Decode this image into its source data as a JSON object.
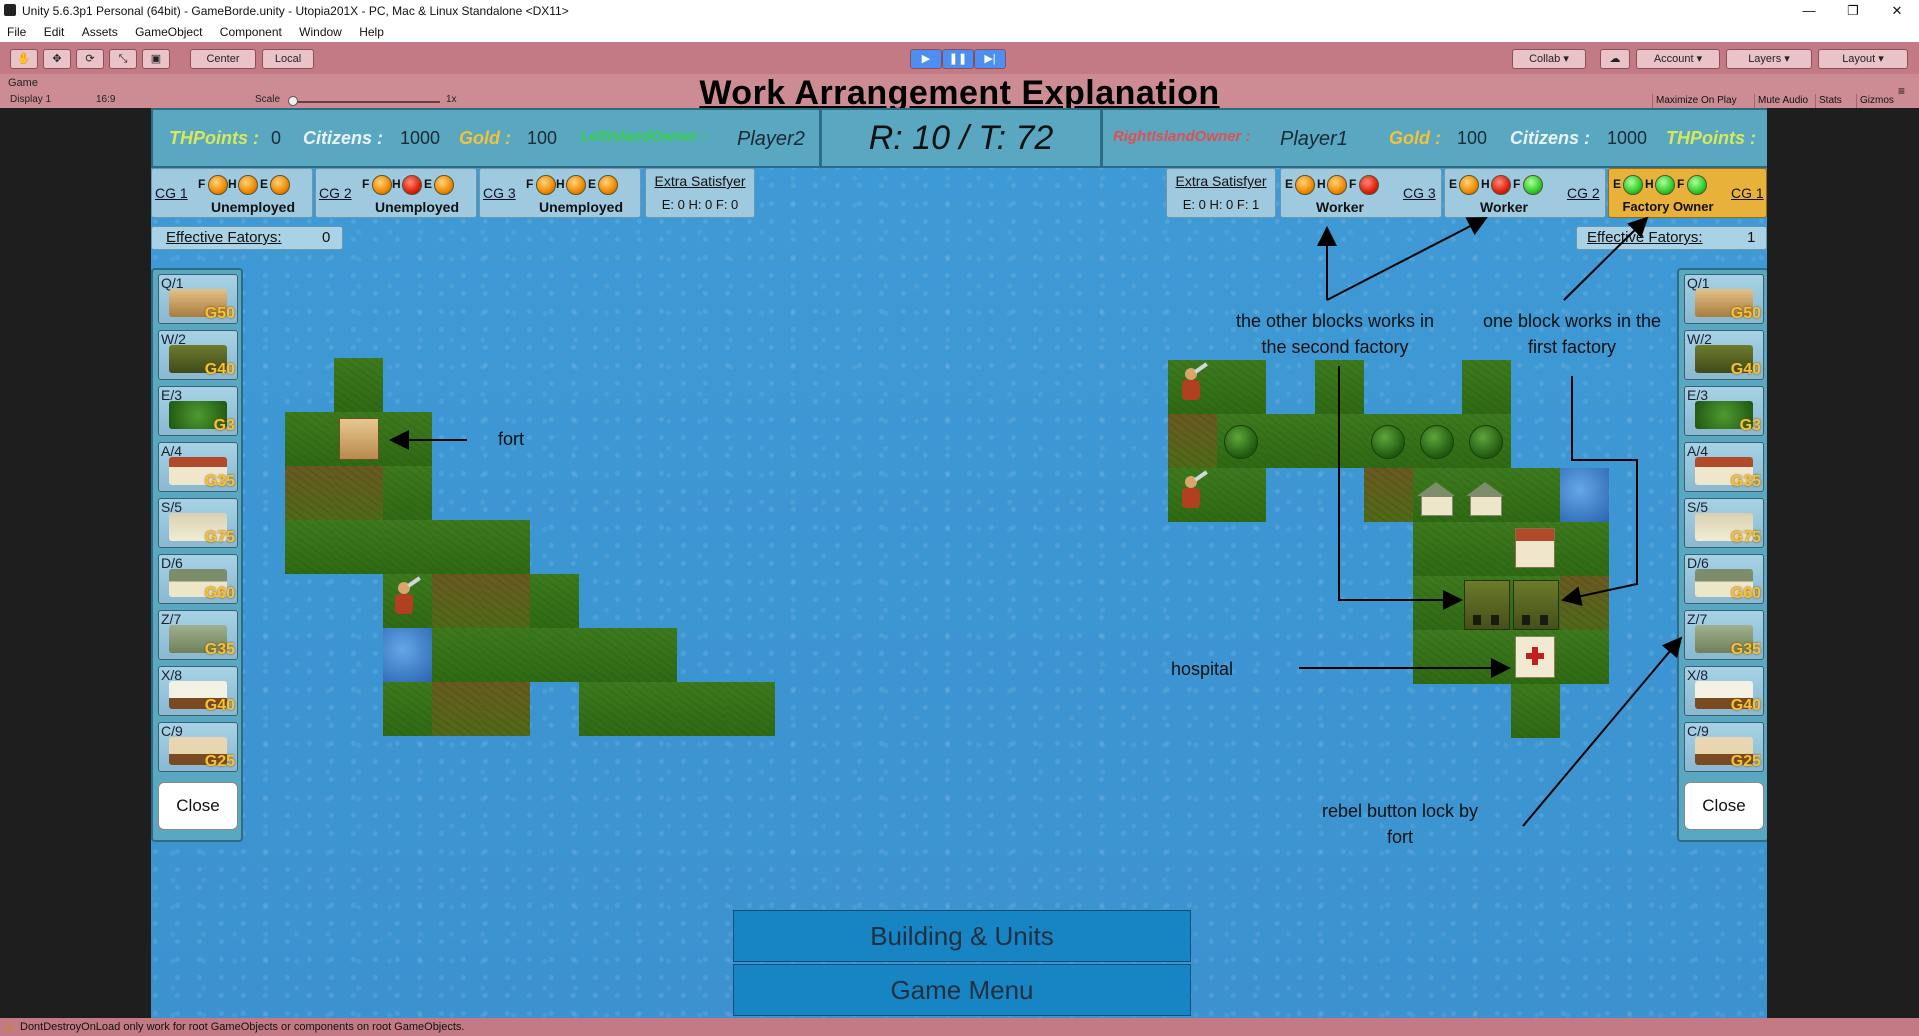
{
  "window": {
    "title": "Unity 5.6.3p1 Personal (64bit) - GameBorde.unity - Utopia201X - PC, Mac & Linux Standalone <DX11>",
    "minimize": "—",
    "restore": "❐",
    "close": "✕"
  },
  "menu": [
    "File",
    "Edit",
    "Assets",
    "GameObject",
    "Component",
    "Window",
    "Help"
  ],
  "toolbar": {
    "center": "Center",
    "local": "Local",
    "collab": "Collab",
    "account": "Account",
    "layers": "Layers",
    "layout": "Layout"
  },
  "gameview": {
    "tab": "Game",
    "display": "Display 1",
    "aspect": "16:9",
    "scale_label": "Scale",
    "scale_value": "1x",
    "maximize": "Maximize On Play",
    "mute": "Mute Audio",
    "stats": "Stats",
    "gizmos": "Gizmos"
  },
  "overlay_title": "Work Arrangement Explanation",
  "hud": {
    "left": {
      "thpoints_label": "THPoints :",
      "thpoints": "0",
      "citizens_label": "Citizens :",
      "citizens": "1000",
      "gold_label": "Gold :",
      "gold": "100",
      "owner_label": "LeftIslandOwner :",
      "player": "Player2"
    },
    "round": "R: 10  /  T: 72",
    "right": {
      "owner_label": "RightIslandOwner :",
      "player": "Player1",
      "gold_label": "Gold :",
      "gold": "100",
      "citizens_label": "Citizens :",
      "citizens": "1000",
      "thpoints_label": "THPoints :",
      "thpoints": "0"
    }
  },
  "left_groups": [
    {
      "label": "CG 1",
      "status": "Unemployed"
    },
    {
      "label": "CG 2",
      "status": "Unemployed"
    },
    {
      "label": "CG 3",
      "status": "Unemployed"
    }
  ],
  "right_groups": [
    {
      "label": "CG 3",
      "status": "Worker"
    },
    {
      "label": "CG 2",
      "status": "Worker"
    },
    {
      "label": "CG 1",
      "status": "Factory Owner"
    }
  ],
  "led_letters": {
    "f": "F",
    "h": "H",
    "e": "E"
  },
  "extra_left": {
    "title": "Extra Satisfyer",
    "stats": "E: 0  H: 0  F: 0"
  },
  "extra_right": {
    "title": "Extra Satisfyer",
    "stats": "E: 0  H: 0  F: 1"
  },
  "effective_left": {
    "label": "Effective Fatorys:",
    "value": "0"
  },
  "effective_right": {
    "label": "Effective Fatorys:",
    "value": "1"
  },
  "build_buttons": [
    {
      "key": "Q/1",
      "cost": "G50"
    },
    {
      "key": "W/2",
      "cost": "G40"
    },
    {
      "key": "E/3",
      "cost": "G3"
    },
    {
      "key": "A/4",
      "cost": "G35"
    },
    {
      "key": "S/5",
      "cost": "G75"
    },
    {
      "key": "D/6",
      "cost": "G60"
    },
    {
      "key": "Z/7",
      "cost": "G35"
    },
    {
      "key": "X/8",
      "cost": "G40"
    },
    {
      "key": "C/9",
      "cost": "G25"
    }
  ],
  "close_label": "Close",
  "annotations": {
    "fort": "fort",
    "other_blocks": "the other blocks works in the second factory",
    "one_block": "one block works in the first factory",
    "hospital": "hospital",
    "rebel": "rebel button lock by fort"
  },
  "buttons": {
    "building_units": "Building & Units",
    "game_menu": "Game Menu"
  },
  "status_message": "DontDestroyOnLoad only work for root GameObjects or components on root GameObjects.",
  "colors": {
    "sea": "#3e9ad6",
    "hud": "#5aa7c2",
    "button": "#1784c4",
    "toolbar": "#c47a84",
    "gold_text": "#f2c23a"
  }
}
